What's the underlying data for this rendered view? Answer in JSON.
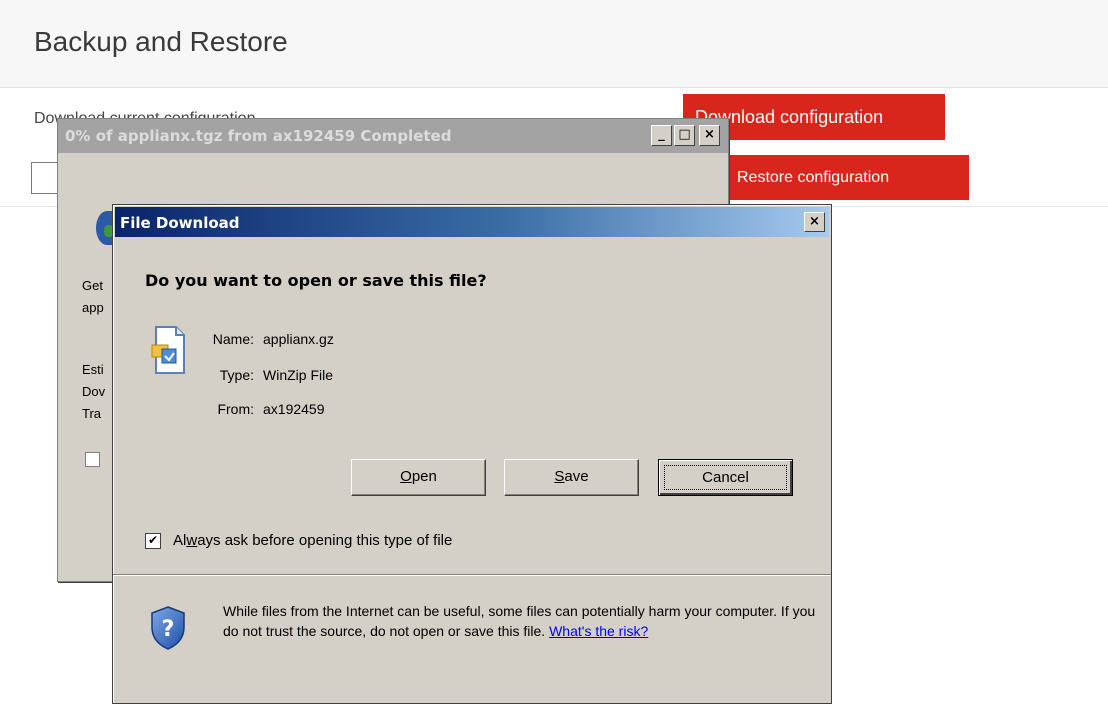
{
  "page": {
    "title": "Backup and Restore",
    "section_label": "Download current configuration",
    "download_button": "Download configuration",
    "restore_button": "Restore configuration"
  },
  "progress_window": {
    "title": "0% of applianx.tgz from ax192459 Completed",
    "lines": [
      "Get",
      "app",
      "Esti",
      "Dov",
      "Tra"
    ],
    "buttons": [
      "_",
      "□",
      "×"
    ]
  },
  "file_download": {
    "title": "File Download",
    "close": "×",
    "question": "Do you want to open or save this file?",
    "labels": {
      "name": "Name:",
      "type": "Type:",
      "from": "From:"
    },
    "values": {
      "name": "applianx.gz",
      "type": "WinZip File",
      "from": "ax192459"
    },
    "buttons": {
      "open": {
        "mnemonic": "O",
        "rest": "pen"
      },
      "save": {
        "mnemonic": "S",
        "rest": "ave"
      },
      "cancel": "Cancel"
    },
    "checkbox": {
      "checked": true,
      "mark": "✔",
      "pre": "Al",
      "mnemonic": "w",
      "post": "ays ask before opening this type of file"
    },
    "warning": "While files from the Internet can be useful, some files can potentially harm your computer. If you do not trust the source, do not open or save this file. ",
    "risk_link": "What's the risk?"
  }
}
